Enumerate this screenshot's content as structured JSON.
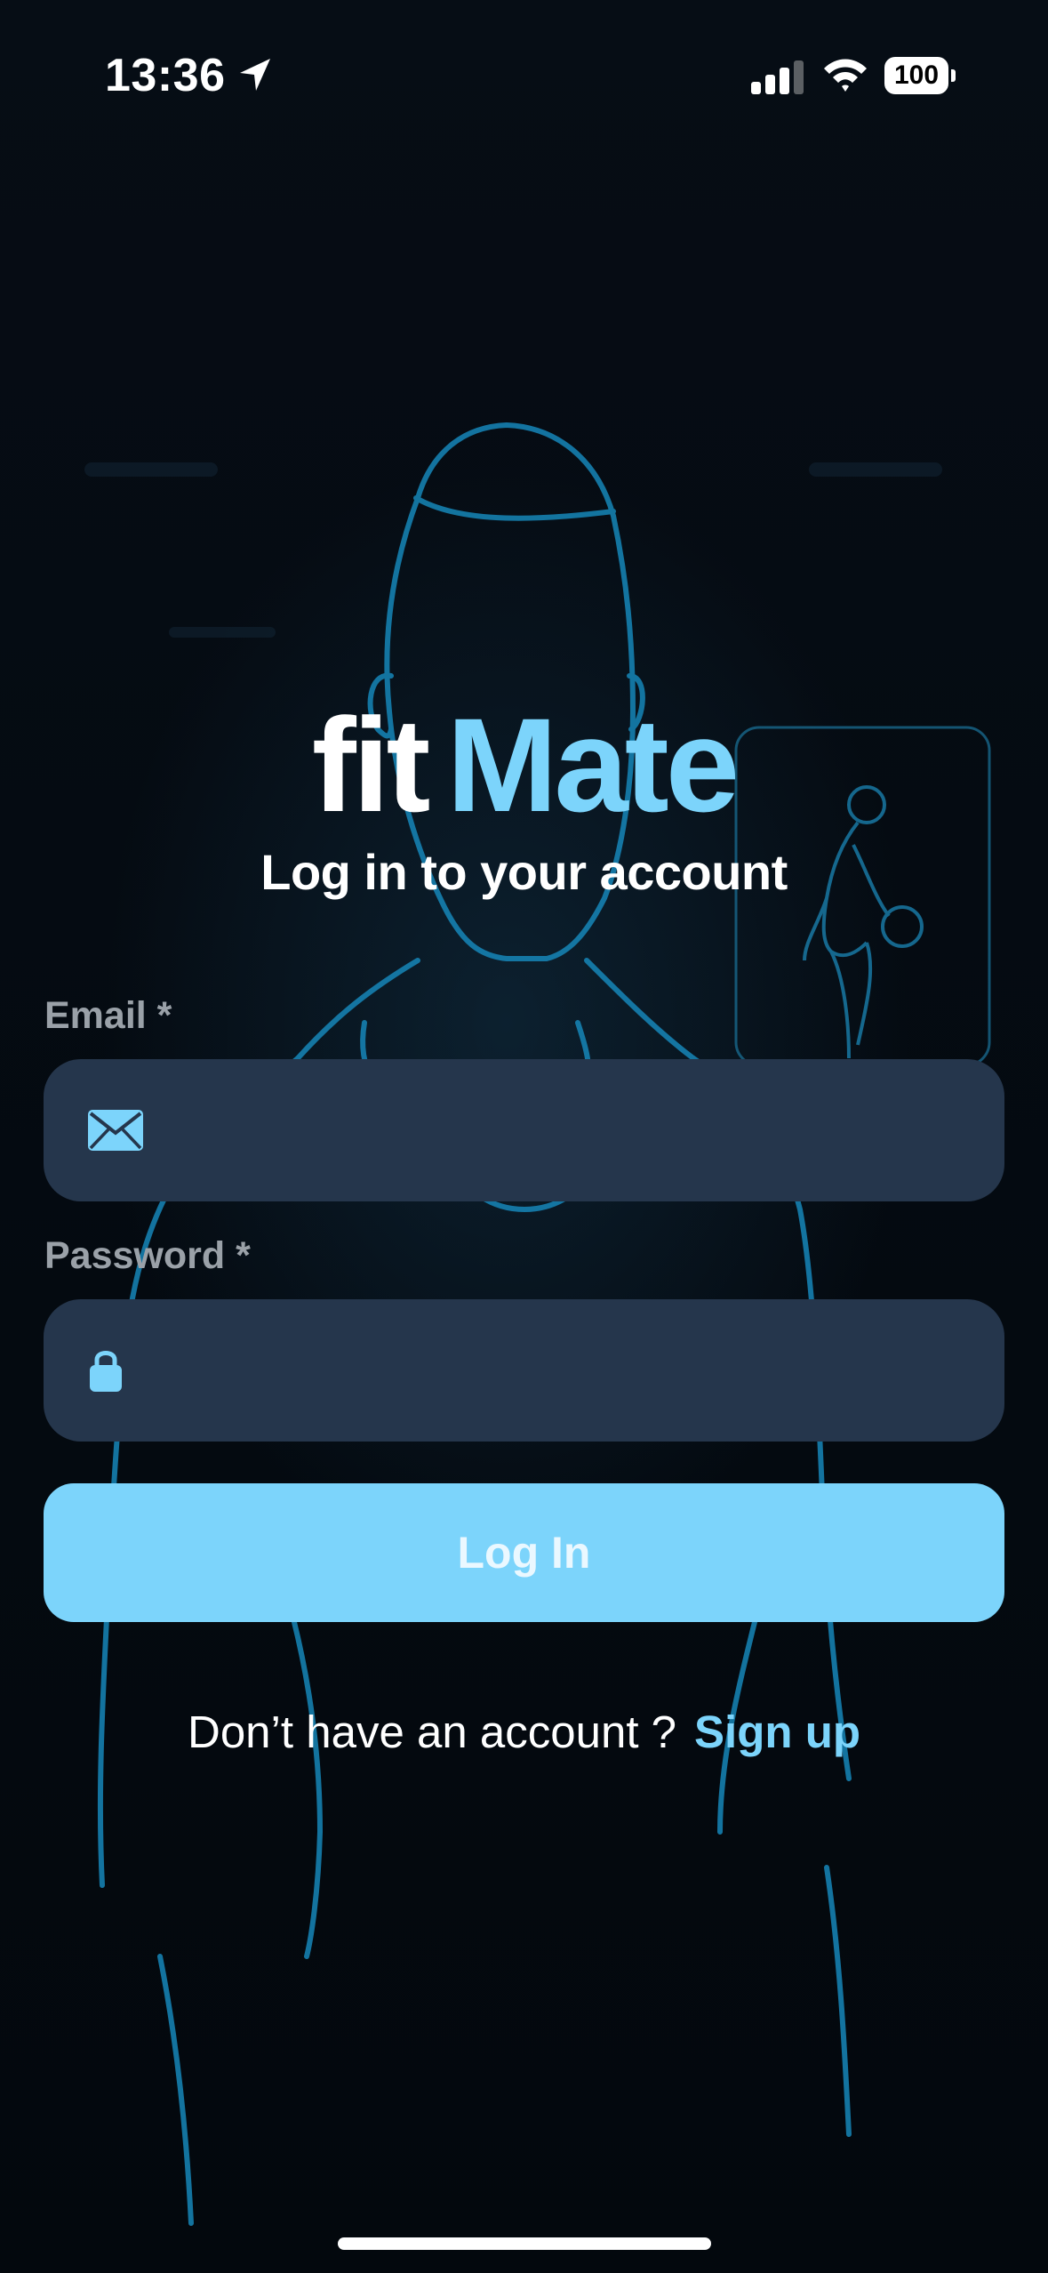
{
  "status_bar": {
    "time": "13:36",
    "battery": "100"
  },
  "logo": {
    "part1": "fit",
    "part2": "Mate",
    "part1_color": "#ffffff",
    "part2_color": "#7cd4fb"
  },
  "subtitle": "Log in to your account",
  "form": {
    "email_label": "Email *",
    "email_value": "",
    "password_label": "Password *",
    "password_value": "",
    "login_label": "Log In"
  },
  "signup": {
    "prompt": "Don’t have an account ?",
    "link": "Sign up"
  },
  "icons": {
    "email": "envelope-icon",
    "password": "lock-icon",
    "status": [
      "location-arrow-icon",
      "signal-icon",
      "wifi-icon",
      "battery-icon"
    ]
  },
  "colors": {
    "accent": "#7cd4fb",
    "field_bg": "#25364c",
    "background": "#04090f"
  }
}
